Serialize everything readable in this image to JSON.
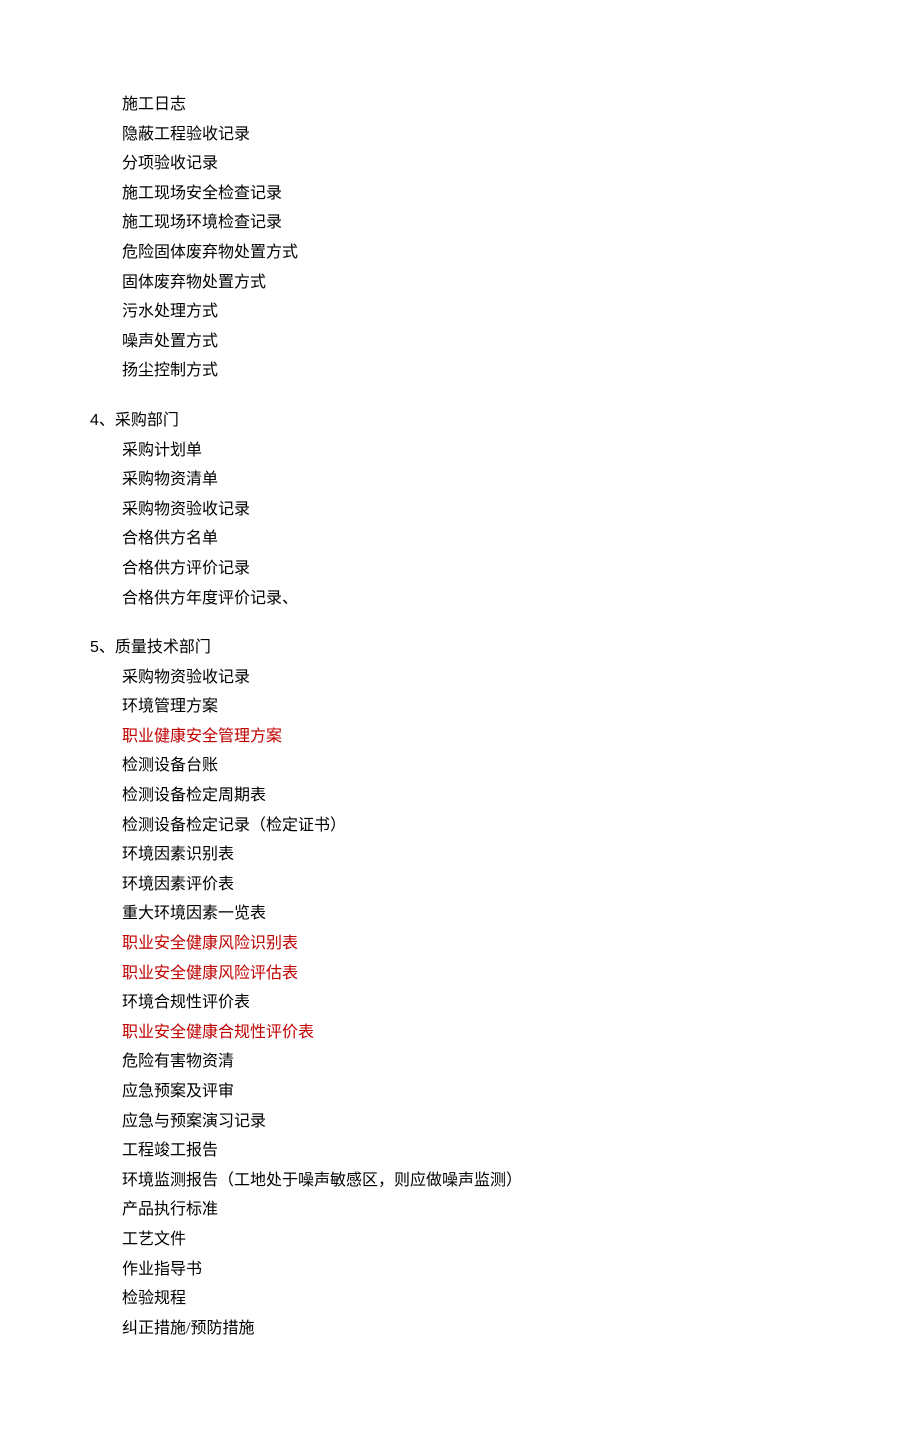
{
  "sections": [
    {
      "header": null,
      "items": [
        {
          "text": "施工日志",
          "highlight": false
        },
        {
          "text": "隐蔽工程验收记录",
          "highlight": false
        },
        {
          "text": "分项验收记录",
          "highlight": false
        },
        {
          "text": "施工现场安全检查记录",
          "highlight": false
        },
        {
          "text": "施工现场环境检查记录",
          "highlight": false
        },
        {
          "text": "危险固体废弃物处置方式",
          "highlight": false
        },
        {
          "text": "固体废弃物处置方式",
          "highlight": false
        },
        {
          "text": "污水处理方式",
          "highlight": false
        },
        {
          "text": "噪声处置方式",
          "highlight": false
        },
        {
          "text": "扬尘控制方式",
          "highlight": false
        }
      ]
    },
    {
      "header": {
        "number": "4",
        "sep": "、",
        "title": "采购部门"
      },
      "items": [
        {
          "text": "采购计划单",
          "highlight": false
        },
        {
          "text": "采购物资清单",
          "highlight": false
        },
        {
          "text": "采购物资验收记录",
          "highlight": false
        },
        {
          "text": "合格供方名单",
          "highlight": false
        },
        {
          "text": "合格供方评价记录",
          "highlight": false
        },
        {
          "text": "合格供方年度评价记录、",
          "highlight": false
        }
      ]
    },
    {
      "header": {
        "number": "5",
        "sep": "、",
        "title": "质量技术部门"
      },
      "items": [
        {
          "text": "采购物资验收记录",
          "highlight": false
        },
        {
          "text": "环境管理方案",
          "highlight": false
        },
        {
          "text": "职业健康安全管理方案",
          "highlight": true
        },
        {
          "text": "检测设备台账",
          "highlight": false
        },
        {
          "text": "检测设备检定周期表",
          "highlight": false
        },
        {
          "text": "检测设备检定记录（检定证书）",
          "highlight": false
        },
        {
          "text": "环境因素识别表",
          "highlight": false
        },
        {
          "text": "环境因素评价表",
          "highlight": false
        },
        {
          "text": "重大环境因素一览表",
          "highlight": false
        },
        {
          "text": "职业安全健康风险识别表",
          "highlight": true
        },
        {
          "text": "职业安全健康风险评估表",
          "highlight": true
        },
        {
          "text": "环境合规性评价表",
          "highlight": false
        },
        {
          "text": "职业安全健康合规性评价表",
          "highlight": true
        },
        {
          "text": "危险有害物资清",
          "highlight": false
        },
        {
          "text": "应急预案及评审",
          "highlight": false
        },
        {
          "text": "应急与预案演习记录",
          "highlight": false
        },
        {
          "text": "工程竣工报告",
          "highlight": false
        },
        {
          "text": "环境监测报告（工地处于噪声敏感区，则应做噪声监测）",
          "highlight": false
        },
        {
          "text": "产品执行标准",
          "highlight": false
        },
        {
          "text": "工艺文件",
          "highlight": false
        },
        {
          "text": "作业指导书",
          "highlight": false
        },
        {
          "text": "检验规程",
          "highlight": false
        },
        {
          "text": "纠正措施/预防措施",
          "highlight": false
        }
      ]
    }
  ]
}
